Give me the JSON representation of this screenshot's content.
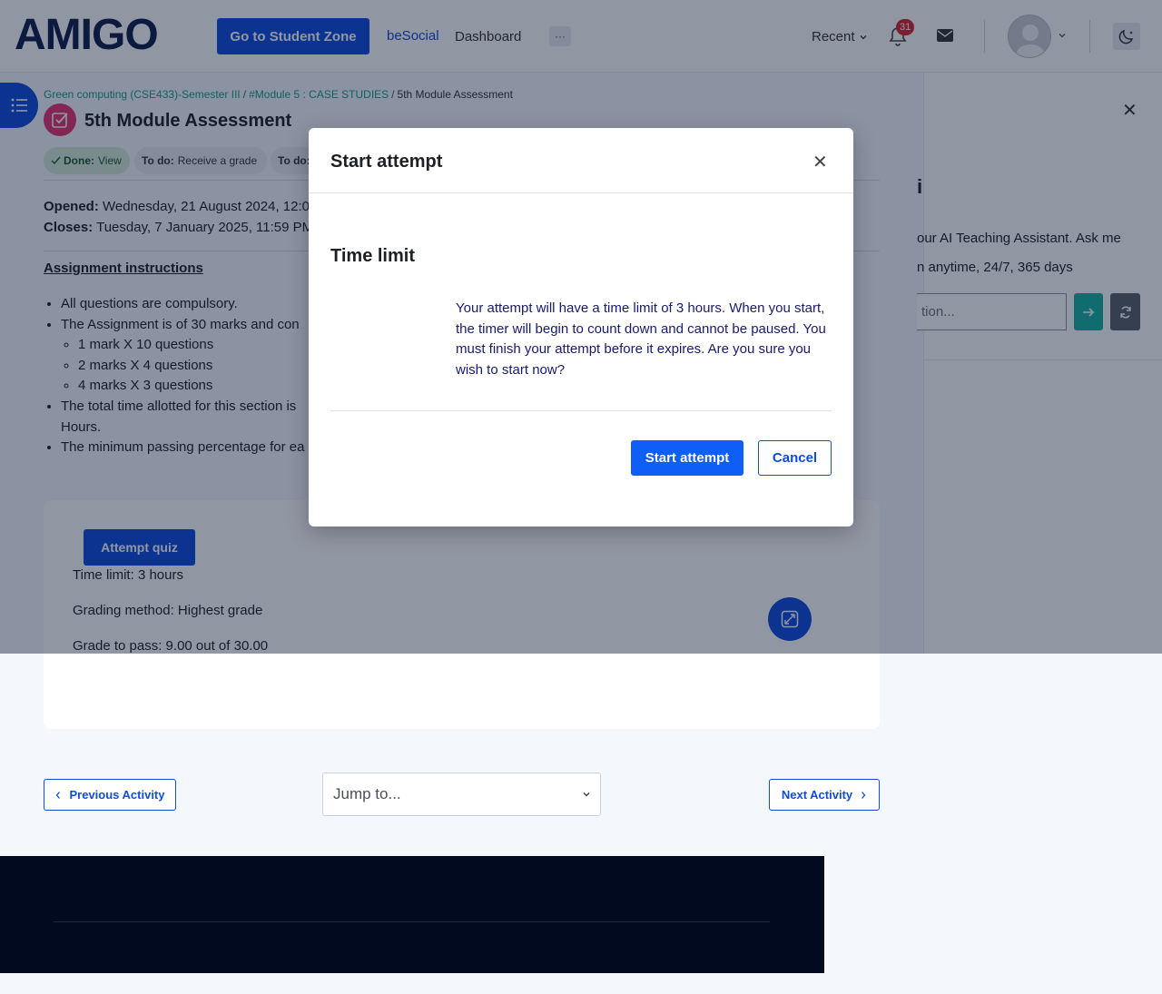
{
  "navbar": {
    "logo_text": "AMIGO",
    "student_zone_label": "Go to Student Zone",
    "besocial_label": "beSocial",
    "dashboard_label": "Dashboard",
    "more_label": "···",
    "recent_label": "Recent",
    "notification_count": "31"
  },
  "breadcrumb": {
    "course": "Green computing (CSE433)-Semester III",
    "module": "#Module 5 : CASE STUDIES",
    "current": "5th Module Assessment"
  },
  "page": {
    "title": "5th Module Assessment",
    "completion": [
      {
        "label": "Done:",
        "value": "View"
      },
      {
        "label": "To do:",
        "value": "Receive a grade"
      },
      {
        "label": "To do:",
        "value": ""
      }
    ],
    "opened_label": "Opened:",
    "opened_value": "Wednesday, 21 August 2024, 12:0",
    "closes_label": "Closes:",
    "closes_value": "Tuesday, 7 January 2025, 11:59 PM"
  },
  "instructions": {
    "title": "Assignment instructions",
    "items": [
      "All questions are compulsory.",
      "The Assignment is of 30 marks and con",
      "1 mark X 10 questions",
      "2 marks X 4 questions",
      "4 marks X 3 questions",
      "The total time allotted for this section is",
      "Hours.",
      "The minimum passing percentage for ea"
    ]
  },
  "quiz": {
    "attempt_label": "Attempt quiz",
    "time_limit": "Time limit: 3 hours",
    "grading_method": "Grading method: Highest grade",
    "grade_to_pass": "Grade to pass: 9.00 out of 30.00"
  },
  "ai_panel": {
    "heading_fragment": "i",
    "line1": "our AI Teaching Assistant. Ask me",
    "line2": "n anytime, 24/7, 365 days",
    "input_placeholder": "tion..."
  },
  "bottom_nav": {
    "prev_label": "Previous Activity",
    "jump_label": "Jump to...",
    "next_label": "Next Activity"
  },
  "modal": {
    "title": "Start attempt",
    "subtitle": "Time limit",
    "body": "Your attempt will have a time limit of 3 hours. When you start, the timer will begin to count down and cannot be paused. You must finish your attempt before it expires. Are you sure you wish to start now?",
    "start_label": "Start attempt",
    "cancel_label": "Cancel"
  },
  "colors": {
    "brand_blue": "#0f4bdc",
    "teal": "#16a085",
    "activity_pink": "#e8336d",
    "footer": "#020a1f"
  }
}
